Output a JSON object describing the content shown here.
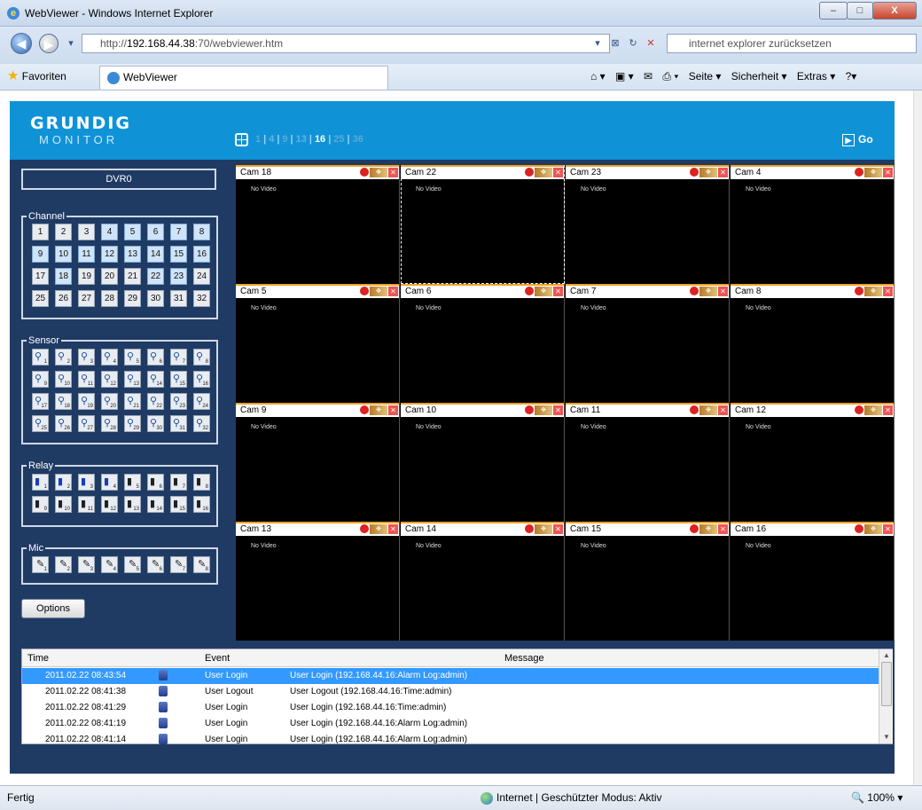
{
  "window": {
    "title": "WebViewer - Windows Internet Explorer",
    "min": "–",
    "max": "□",
    "close": "X"
  },
  "address": {
    "url_prefix": "http://",
    "url_host": "192.168.44.38",
    "url_rest": ":70/webviewer.htm",
    "search_placeholder": "internet explorer zurücksetzen"
  },
  "favbar": {
    "favorites": "Favoriten",
    "tab_title": "WebViewer",
    "commands": [
      "Seite ▾",
      "Sicherheit ▾",
      "Extras ▾"
    ]
  },
  "app": {
    "logo_line1": "GRUNDIG",
    "logo_line2": "MONITOR",
    "splits": [
      {
        "label": "1",
        "state": "dim"
      },
      {
        "label": "4",
        "state": "normal"
      },
      {
        "label": "9",
        "state": "dim"
      },
      {
        "label": "13",
        "state": "normal"
      },
      {
        "label": "16",
        "state": "active"
      },
      {
        "label": "25",
        "state": "dim"
      },
      {
        "label": "36",
        "state": "dim"
      }
    ],
    "go_label": "Go",
    "dvr_label": "DVR0",
    "channel_legend": "Channel",
    "channels": [
      "1",
      "2",
      "3",
      "4",
      "5",
      "6",
      "7",
      "8",
      "9",
      "10",
      "11",
      "12",
      "13",
      "14",
      "15",
      "16",
      "17",
      "18",
      "19",
      "20",
      "21",
      "22",
      "23",
      "24",
      "25",
      "26",
      "27",
      "28",
      "29",
      "30",
      "31",
      "32"
    ],
    "channels_highlight": [
      "4",
      "5",
      "6",
      "7",
      "8",
      "9",
      "10",
      "11",
      "12",
      "13",
      "14",
      "15",
      "16",
      "18",
      "22",
      "23"
    ],
    "sensor_legend": "Sensor",
    "sensors": [
      "1",
      "2",
      "3",
      "4",
      "5",
      "6",
      "7",
      "8",
      "9",
      "10",
      "11",
      "12",
      "13",
      "14",
      "15",
      "16",
      "17",
      "18",
      "19",
      "20",
      "21",
      "22",
      "23",
      "24",
      "25",
      "26",
      "27",
      "28",
      "29",
      "30",
      "31",
      "32"
    ],
    "relay_legend": "Relay",
    "relays": [
      "1",
      "2",
      "3",
      "4",
      "5",
      "6",
      "7",
      "8",
      "9",
      "10",
      "11",
      "12",
      "13",
      "14",
      "15",
      "16"
    ],
    "relays_on": [
      "1",
      "2",
      "3",
      "4"
    ],
    "mic_legend": "Mic",
    "mics": [
      "1",
      "2",
      "3",
      "4",
      "5",
      "6",
      "7",
      "8"
    ],
    "options_label": "Options"
  },
  "cameras": [
    {
      "name": "Cam 18",
      "status": "No Video"
    },
    {
      "name": "Cam 22",
      "status": "No Video",
      "selected": true
    },
    {
      "name": "Cam 23",
      "status": "No Video"
    },
    {
      "name": "Cam 4",
      "status": "No Video"
    },
    {
      "name": "Cam 5",
      "status": "No Video"
    },
    {
      "name": "Cam 6",
      "status": "No Video"
    },
    {
      "name": "Cam 7",
      "status": "No Video"
    },
    {
      "name": "Cam 8",
      "status": "No Video"
    },
    {
      "name": "Cam 9",
      "status": "No Video"
    },
    {
      "name": "Cam 10",
      "status": "No Video"
    },
    {
      "name": "Cam 11",
      "status": "No Video"
    },
    {
      "name": "Cam 12",
      "status": "No Video"
    },
    {
      "name": "Cam 13",
      "status": "No Video"
    },
    {
      "name": "Cam 14",
      "status": "No Video"
    },
    {
      "name": "Cam 15",
      "status": "No Video"
    },
    {
      "name": "Cam 16",
      "status": "No Video"
    }
  ],
  "log": {
    "columns": [
      "Time",
      "Event",
      "Message"
    ],
    "rows": [
      {
        "time": "2011.02.22 08:43:54",
        "event": "User Login",
        "message": "User Login (192.168.44.16:Alarm Log:admin)",
        "selected": true
      },
      {
        "time": "2011.02.22 08:41:38",
        "event": "User Logout",
        "message": "User Logout (192.168.44.16:Time:admin)"
      },
      {
        "time": "2011.02.22 08:41:29",
        "event": "User Login",
        "message": "User Login (192.168.44.16:Time:admin)"
      },
      {
        "time": "2011.02.22 08:41:19",
        "event": "User Login",
        "message": "User Login (192.168.44.16:Alarm Log:admin)"
      },
      {
        "time": "2011.02.22 08:41:14",
        "event": "User Login",
        "message": "User Login (192.168.44.16:Alarm Log:admin)"
      }
    ]
  },
  "status": {
    "left": "Fertig",
    "zone": "Internet | Geschützter Modus: Aktiv",
    "zoom": "100%"
  },
  "colors": {
    "header_blue": "#0f93d6",
    "panel_navy": "#1f3b64",
    "selection_blue": "#3399ff",
    "tab_accent": "#f0a020"
  }
}
